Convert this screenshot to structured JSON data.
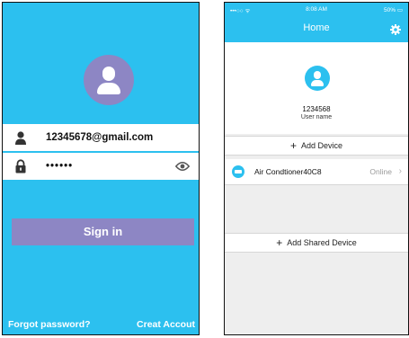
{
  "login": {
    "email_value": "12345678@gmail.com",
    "password_masked": "••••••",
    "signin_label": "Sign in",
    "forgot_label": "Forgot password?",
    "create_label": "Creat Accout",
    "colors": {
      "background": "#2cc0ef",
      "accent": "#8d86c4"
    }
  },
  "home": {
    "status": {
      "carrier": "•••○○ ᯤ",
      "time": "8:08 AM",
      "battery": "50% ▭"
    },
    "title": "Home",
    "user_id": "1234568",
    "user_name_label": "User name",
    "add_device_label": "Add Device",
    "devices": [
      {
        "name": "Air Condtioner40C8",
        "status": "Online",
        "chevron": "›",
        "icon": "air-conditioner-icon"
      }
    ],
    "add_shared_label": "Add Shared Device",
    "plus_symbol": "+",
    "colors": {
      "header": "#2cc0ef",
      "background": "#eeeeee"
    }
  }
}
